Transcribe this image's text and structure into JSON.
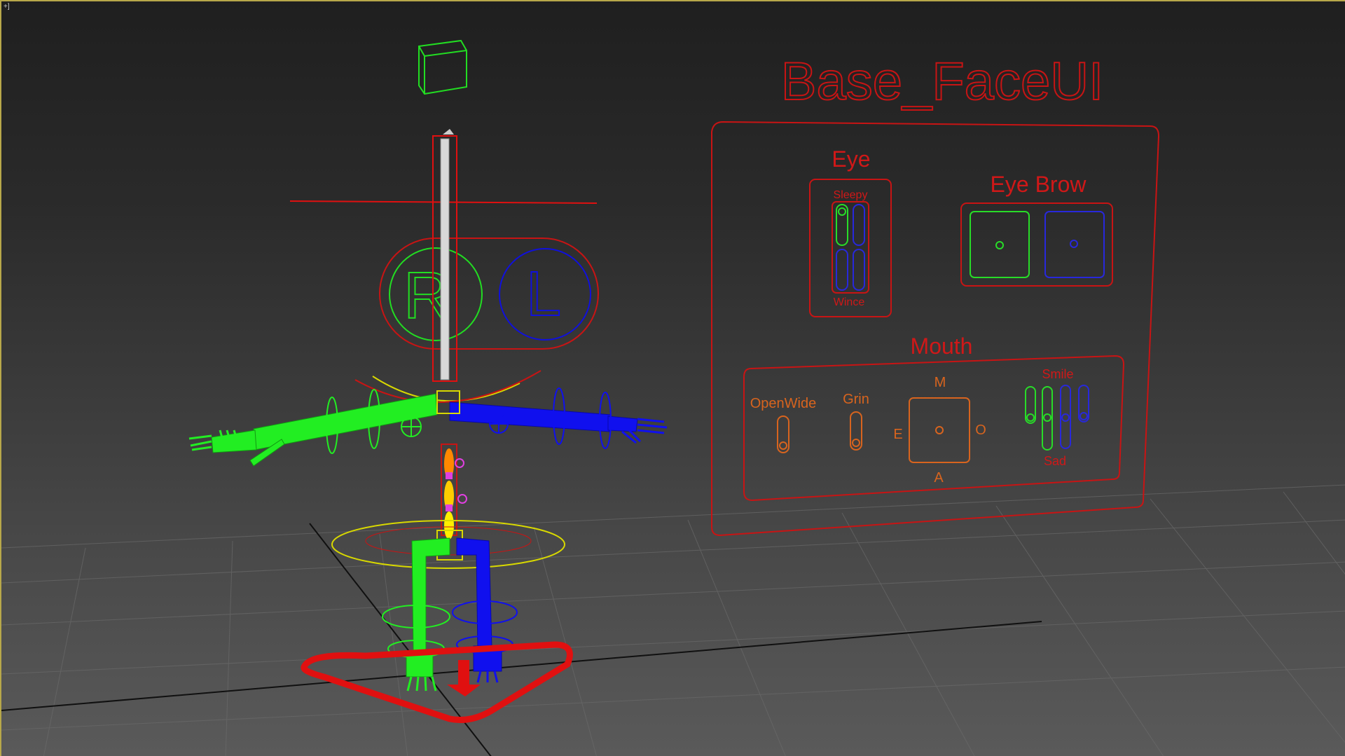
{
  "viewport": {
    "corner_label": "+]",
    "active_border_color": "#b8a84a"
  },
  "face_ui": {
    "title": "Base_FaceUI",
    "eye": {
      "label": "Eye",
      "top_label": "Sleepy",
      "bottom_label": "Wince"
    },
    "eyebrow": {
      "label": "Eye Brow"
    },
    "mouth": {
      "label": "Mouth",
      "openwide_label": "OpenWide",
      "grin_label": "Grin",
      "smile_label": "Smile",
      "sad_label": "Sad",
      "phoneme_top": "M",
      "phoneme_left": "E",
      "phoneme_right": "O",
      "phoneme_bottom": "A"
    },
    "colors": {
      "frame": "#c81414",
      "orange": "#d8641e",
      "green": "#28dc28",
      "blue": "#2828dc"
    }
  },
  "rig": {
    "side_right_label": "R",
    "side_left_label": "L",
    "colors": {
      "right_side": "#22ee22",
      "left_side": "#1010ee",
      "center": "#d8d800",
      "spine": "#ffcc00",
      "root": "#e01010",
      "helper": "#e040e0"
    }
  }
}
